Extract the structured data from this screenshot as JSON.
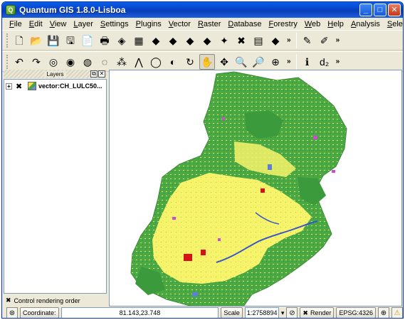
{
  "window": {
    "title": "Quantum GIS 1.8.0-Lisboa",
    "app_icon": "Q",
    "controls": {
      "minimize": "_",
      "maximize": "□",
      "close": "✕"
    }
  },
  "menu": [
    "File",
    "Edit",
    "View",
    "Layer",
    "Settings",
    "Plugins",
    "Vector",
    "Raster",
    "Database",
    "Forestry",
    "Web",
    "Help",
    "Analysis",
    "SelectPlus"
  ],
  "toolbar1": [
    {
      "name": "new-project-icon",
      "glyph": "🗋"
    },
    {
      "name": "open-project-icon",
      "glyph": "📂"
    },
    {
      "name": "save-project-icon",
      "glyph": "💾"
    },
    {
      "name": "save-as-icon",
      "glyph": "🖫"
    },
    {
      "name": "print-composer-icon",
      "glyph": "📄"
    },
    {
      "name": "print-icon",
      "glyph": "🖶"
    },
    {
      "name": "add-vector-layer-icon",
      "glyph": "◈"
    },
    {
      "name": "add-raster-layer-icon",
      "glyph": "▦"
    },
    {
      "name": "add-postgis-layer-icon",
      "glyph": "◆"
    },
    {
      "name": "add-spatialite-layer-icon",
      "glyph": "◆"
    },
    {
      "name": "add-wms-layer-icon",
      "glyph": "◆"
    },
    {
      "name": "add-wfs-layer-icon",
      "glyph": "◆"
    },
    {
      "name": "new-layer-icon",
      "glyph": "✦"
    },
    {
      "name": "remove-layer-icon",
      "glyph": "✖"
    },
    {
      "name": "add-delimited-text-icon",
      "glyph": "▤"
    },
    {
      "name": "add-oracle-layer-icon",
      "glyph": "◆"
    }
  ],
  "toolbar1_extra": [
    {
      "name": "toggle-editing-icon",
      "glyph": "✎"
    },
    {
      "name": "digitize-icon",
      "glyph": "✐"
    }
  ],
  "toolbar2": [
    {
      "name": "undo-icon",
      "glyph": "↶"
    },
    {
      "name": "redo-icon",
      "glyph": "↷"
    },
    {
      "name": "add-ring-icon",
      "glyph": "◎"
    },
    {
      "name": "add-part-icon",
      "glyph": "◉"
    },
    {
      "name": "fill-ring-icon",
      "glyph": "◍"
    },
    {
      "name": "delete-ring-icon",
      "glyph": "◌"
    },
    {
      "name": "node-tool-icon",
      "glyph": "⁂"
    },
    {
      "name": "offset-curve-icon",
      "glyph": "⋀"
    },
    {
      "name": "simplify-icon",
      "glyph": "◯"
    },
    {
      "name": "reshape-icon",
      "glyph": "◐"
    },
    {
      "name": "rotate-icon",
      "glyph": "↻"
    },
    {
      "name": "pan-map-icon",
      "glyph": "✋"
    },
    {
      "name": "pan-to-selection-icon",
      "glyph": "✥"
    },
    {
      "name": "zoom-in-icon",
      "glyph": "🔍"
    },
    {
      "name": "zoom-out-icon",
      "glyph": "🔎"
    },
    {
      "name": "zoom-full-icon",
      "glyph": "⊕"
    }
  ],
  "toolbar2_extra": [
    {
      "name": "identify-icon",
      "glyph": "ℹ"
    },
    {
      "name": "measure-icon",
      "glyph": "d₂"
    }
  ],
  "dock": {
    "title": "Layers",
    "float_button": "⧉",
    "close_button": "✕"
  },
  "layers": [
    {
      "expander": "+",
      "checked": "✖",
      "label": "vector:CH_LULC50..."
    }
  ],
  "render_order": {
    "mark": "✖",
    "label": "Control rendering order"
  },
  "status": {
    "coordinate_label": "Coordinate:",
    "coordinate_value": "81.143,23.748",
    "scale_label": "Scale",
    "scale_value": "1:2758894",
    "render_label": "Render",
    "epsg": "EPSG:4326"
  },
  "colors": {
    "title_bar": "#0a50d8",
    "window_bg": "#ece9d8",
    "map_yellow": "#f7f36a",
    "map_green": "#4aa845",
    "map_blue": "#4a6fd0",
    "map_magenta": "#d14ad3",
    "map_red": "#d7101a"
  }
}
